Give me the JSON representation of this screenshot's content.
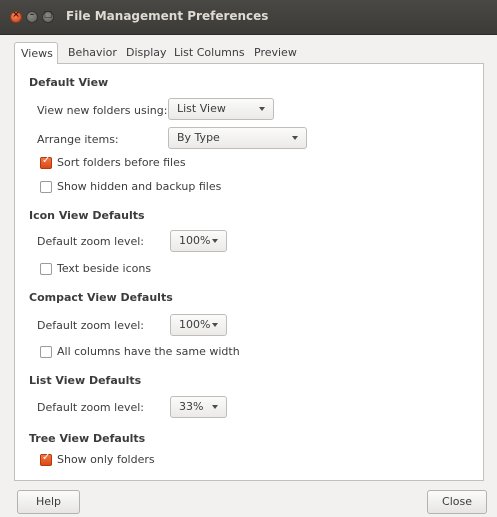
{
  "window": {
    "title": "File Management Preferences",
    "close_glyph": "×",
    "minimize_glyph": "–",
    "maximize_glyph": "□"
  },
  "tabs": [
    "Views",
    "Behavior",
    "Display",
    "List Columns",
    "Preview"
  ],
  "active_tab": "Views",
  "default_view": {
    "heading": "Default View",
    "view_new_folders_label": "View new folders using:",
    "view_new_folders_value": "List View",
    "arrange_items_label": "Arrange items:",
    "arrange_items_value": "By Type",
    "sort_folders_label": "Sort folders before files",
    "sort_folders_checked": true,
    "show_hidden_label": "Show hidden and backup files",
    "show_hidden_checked": false
  },
  "icon_view": {
    "heading": "Icon View Defaults",
    "zoom_label": "Default zoom level:",
    "zoom_value": "100%",
    "text_beside_label": "Text beside icons",
    "text_beside_checked": false
  },
  "compact_view": {
    "heading": "Compact View Defaults",
    "zoom_label": "Default zoom level:",
    "zoom_value": "100%",
    "same_width_label": "All columns have the same width",
    "same_width_checked": false
  },
  "list_view": {
    "heading": "List View Defaults",
    "zoom_label": "Default zoom level:",
    "zoom_value": "33%"
  },
  "tree_view": {
    "heading": "Tree View Defaults",
    "only_folders_label": "Show only folders",
    "only_folders_checked": true
  },
  "buttons": {
    "help": "Help",
    "close": "Close"
  },
  "colors": {
    "titlebar": "#3c3b37",
    "title_text": "#dfdbd2",
    "accent_orange": "#dd4814",
    "window_bg": "#f2f1f0",
    "panel_bg": "#ffffff"
  }
}
